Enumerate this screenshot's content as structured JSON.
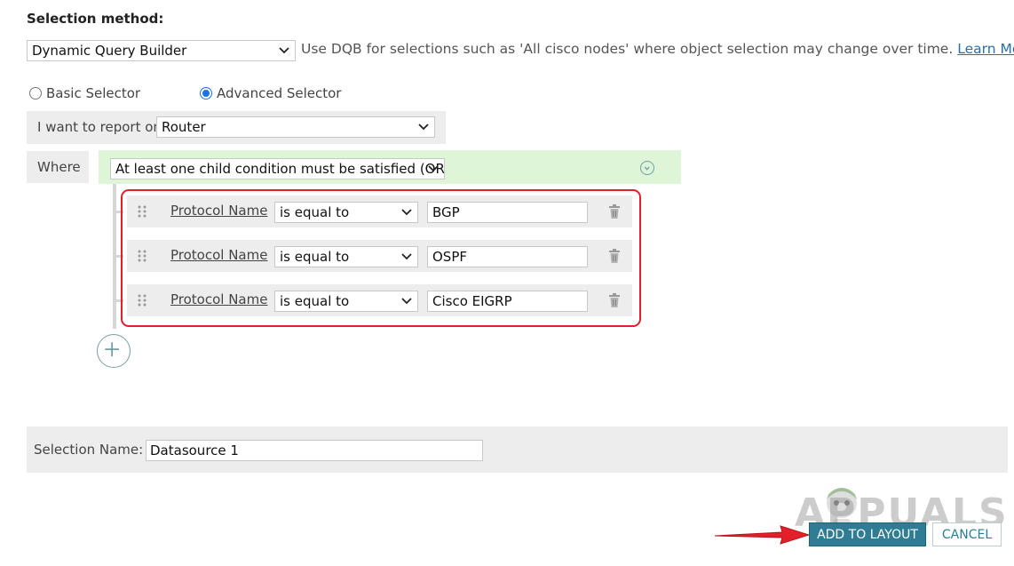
{
  "selection_method": {
    "title": "Selection method:",
    "selected": "Dynamic Query Builder",
    "hint": "Use DQB for selections such as 'All cisco nodes' where object selection may change over time.",
    "learn_more": "Learn More"
  },
  "selector": {
    "basic": "Basic Selector",
    "advanced": "Advanced Selector",
    "active": "advanced"
  },
  "report_on": {
    "label": "I want to report on",
    "selected": "Router"
  },
  "where": {
    "label": "Where",
    "condition": "At least one child condition must be satisfied (OR)"
  },
  "conditions": [
    {
      "field": "Protocol Name",
      "operator": "is equal to",
      "value": "BGP"
    },
    {
      "field": "Protocol Name",
      "operator": "is equal to",
      "value": "OSPF"
    },
    {
      "field": "Protocol Name",
      "operator": "is equal to",
      "value": "Cisco EIGRP"
    }
  ],
  "selection_name": {
    "label": "Selection Name:",
    "value": "Datasource 1"
  },
  "buttons": {
    "add": "ADD TO LAYOUT",
    "cancel": "CANCEL"
  },
  "watermark": "APPUALS",
  "colors": {
    "primary": "#2e7d94",
    "highlight": "#e3202a",
    "condition_bg": "#dff5d8",
    "link": "#2b6ea9"
  },
  "icons": {
    "dropdown": "chevron-down-icon",
    "drag": "drag-handle-icon",
    "delete": "trash-icon",
    "collapse": "collapse-circle-icon",
    "add": "plus-circle-icon",
    "arrow": "red-arrow-icon"
  }
}
